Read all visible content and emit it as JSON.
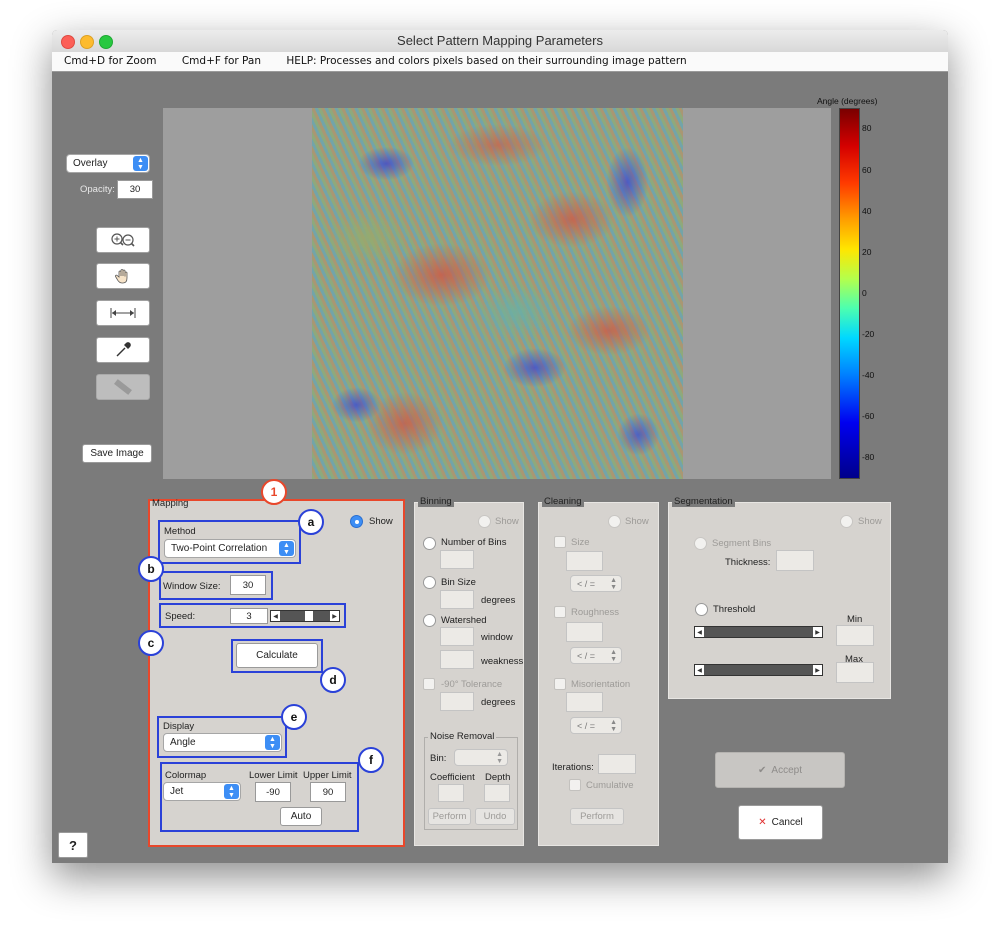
{
  "window": {
    "title": "Select Pattern Mapping Parameters"
  },
  "menubar": {
    "zoom_hint": "Cmd+D for Zoom",
    "pan_hint": "Cmd+F for Pan",
    "help": "HELP:  Processes and colors pixels based on their surrounding image pattern"
  },
  "left_tools": {
    "view_mode": "Overlay",
    "opacity_label": "Opacity:",
    "opacity_value": "30",
    "save_image": "Save Image",
    "help_button": "?"
  },
  "colorbar": {
    "title": "Angle (degrees)",
    "ticks": [
      "80",
      "60",
      "40",
      "20",
      "0",
      "-20",
      "-40",
      "-60",
      "-80"
    ]
  },
  "annotations": {
    "main": "1",
    "method": "a",
    "window_size": "b",
    "speed": "c",
    "calculate": "d",
    "display": "e",
    "colormap": "f"
  },
  "mapping": {
    "title": "Mapping",
    "show": "Show",
    "method_label": "Method",
    "method_value": "Two-Point Correlation",
    "window_size_label": "Window Size:",
    "window_size_value": "30",
    "speed_label": "Speed:",
    "speed_value": "3",
    "calculate": "Calculate",
    "display_label": "Display",
    "display_value": "Angle",
    "colormap_label": "Colormap",
    "colormap_value": "Jet",
    "lower_limit_label": "Lower Limit",
    "lower_limit_value": "-90",
    "upper_limit_label": "Upper Limit",
    "upper_limit_value": "90",
    "auto": "Auto"
  },
  "binning": {
    "title": "Binning",
    "show": "Show",
    "number_of_bins": "Number of Bins",
    "bin_size": "Bin Size",
    "degrees": "degrees",
    "watershed": "Watershed",
    "window": "window",
    "weakness": "weakness",
    "tolerance": "-90° Tolerance",
    "degrees2": "degrees",
    "noise_removal": "Noise Removal",
    "bin_label": "Bin:",
    "coefficient": "Coefficient",
    "depth": "Depth",
    "perform": "Perform",
    "undo": "Undo"
  },
  "cleaning": {
    "title": "Cleaning",
    "show": "Show",
    "size": "Size",
    "cmp1": "< / =",
    "roughness": "Roughness",
    "cmp2": "< / =",
    "misorientation": "Misorientation",
    "cmp3": "< / =",
    "iterations": "Iterations:",
    "cumulative": "Cumulative",
    "perform": "Perform"
  },
  "segmentation": {
    "title": "Segmentation",
    "show": "Show",
    "segment_bins": "Segment Bins",
    "thickness": "Thickness:",
    "threshold": "Threshold",
    "min": "Min",
    "max": "Max"
  },
  "actions": {
    "accept": "Accept",
    "cancel": "Cancel"
  }
}
